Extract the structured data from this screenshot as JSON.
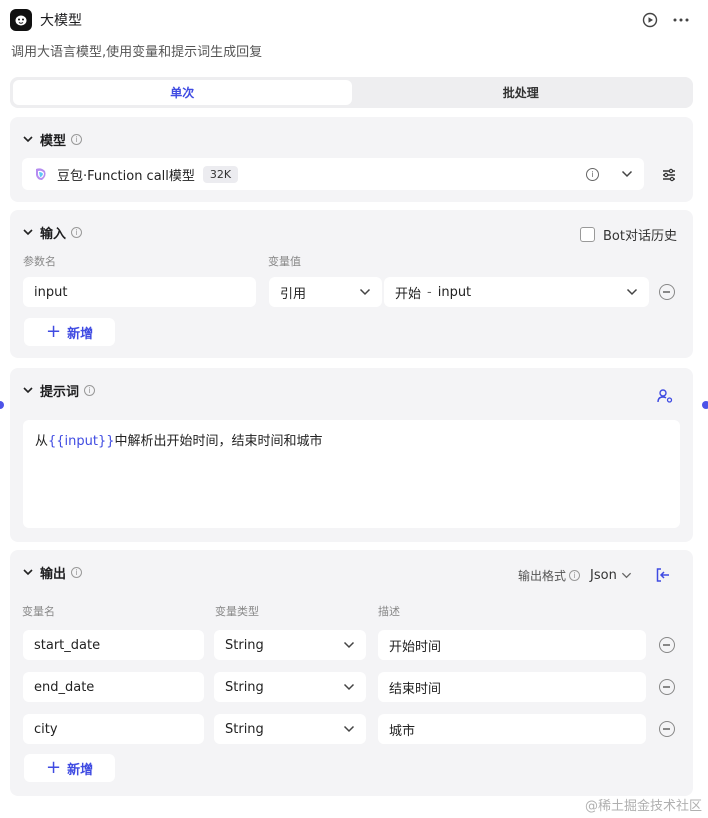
{
  "header": {
    "title": "大模型",
    "description": "调用大语言模型,使用变量和提示词生成回复"
  },
  "tabs": [
    {
      "label": "单次",
      "active": true
    },
    {
      "label": "批处理",
      "active": false
    }
  ],
  "model": {
    "section_title": "模型",
    "model_name": "豆包·Function call模型",
    "context_badge": "32K"
  },
  "input": {
    "section_title": "输入",
    "bot_history_label": "Bot对话历史",
    "col_param": "参数名",
    "col_value": "变量值",
    "rows": [
      {
        "name": "input",
        "mode": "引用",
        "ref_node": "开始",
        "ref_sep": "-",
        "ref_var": "input"
      }
    ],
    "add_label": "新增"
  },
  "prompt": {
    "section_title": "提示词",
    "text_prefix": "从",
    "text_var": "{{input}}",
    "text_suffix": "中解析出开始时间，结束时间和城市"
  },
  "output": {
    "section_title": "输出",
    "format_label": "输出格式",
    "format_value": "Json",
    "col_name": "变量名",
    "col_type": "变量类型",
    "col_desc": "描述",
    "rows": [
      {
        "name": "start_date",
        "type": "String",
        "desc": "开始时间"
      },
      {
        "name": "end_date",
        "type": "String",
        "desc": "结束时间"
      },
      {
        "name": "city",
        "type": "String",
        "desc": "城市"
      }
    ],
    "add_label": "新增"
  },
  "watermark": "@稀土掘金技术社区",
  "colors": {
    "accent": "#3f4be2",
    "section_bg": "#f4f4f6"
  }
}
